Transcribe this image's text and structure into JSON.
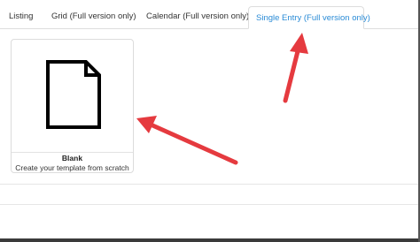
{
  "tabs": [
    {
      "label": "Listing",
      "active": false
    },
    {
      "label": "Grid (Full version only)",
      "active": false
    },
    {
      "label": "Calendar (Full version only)",
      "active": false
    },
    {
      "label": "Single Entry (Full version only)",
      "active": true
    }
  ],
  "template_card": {
    "icon": "blank-document-icon",
    "title": "Blank",
    "description": "Create your template from scratch"
  },
  "colors": {
    "active_tab_text": "#2a8bd6",
    "annotation_arrow": "#e53a3f"
  }
}
